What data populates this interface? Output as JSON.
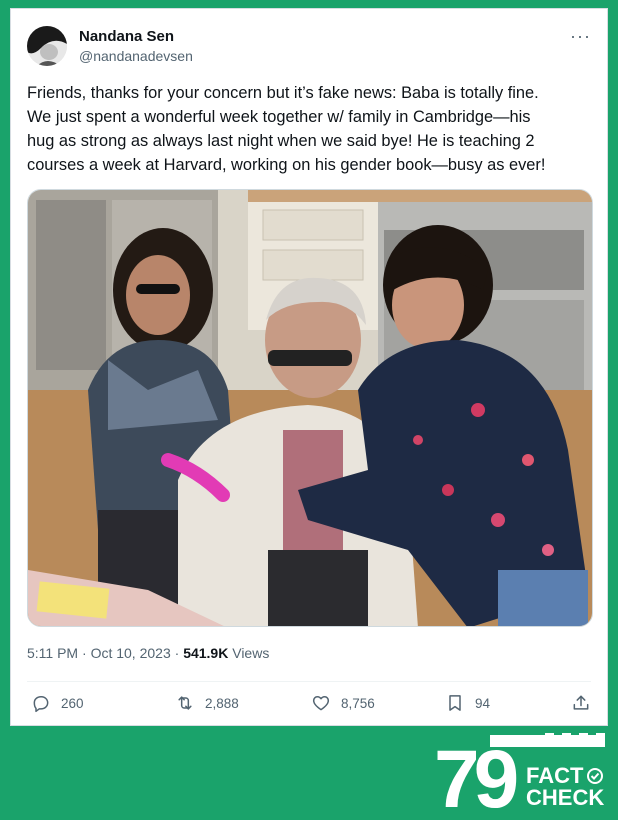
{
  "tweet": {
    "author_name": "Nandana Sen",
    "author_handle": "@nandanadevsen",
    "more_label": "···",
    "text": "Friends, thanks for your concern but it’s fake news: Baba is totally fine.\nWe just spent a wonderful week together w/ family in Cambridge—his\nhug as strong as always last night when we said bye! He is teaching 2\ncourses a week at Harvard, working on his gender book—busy as ever!",
    "time": "5:11 PM",
    "separator": "·",
    "date": "Oct 10, 2023",
    "views_count": "541.9K",
    "views_label": "Views"
  },
  "actions": {
    "replies": "260",
    "reposts": "2,888",
    "likes": "8,756",
    "bookmarks": "94"
  },
  "icons": [
    "reply-icon",
    "repost-icon",
    "like-icon",
    "bookmark-icon",
    "share-icon",
    "more-icon"
  ],
  "watermark": {
    "brand_number": "79",
    "line1": "FACT",
    "line2": "CHECK"
  },
  "colors": {
    "background_green": "#1aa36b",
    "text_primary": "#0f1419",
    "text_secondary": "#536471"
  }
}
